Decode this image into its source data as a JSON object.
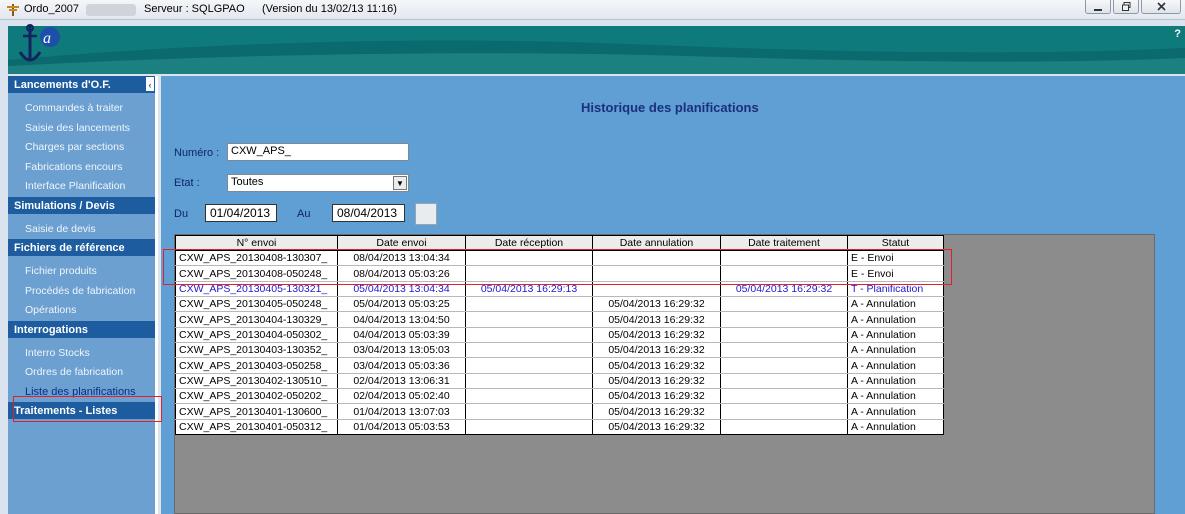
{
  "titlebar": {
    "app_name": "Ordo_2007",
    "server": "Serveur : SQLGPAO",
    "version": "(Version du 13/02/13 11:16)"
  },
  "banner": {
    "help": "?"
  },
  "sidebar": {
    "sections": [
      {
        "title": "Lancements d'O.F.",
        "items": [
          "Commandes à traiter",
          "Saisie des lancements",
          "Charges par sections",
          "Fabrications encours",
          "Interface Planification"
        ]
      },
      {
        "title": "Simulations / Devis",
        "items": [
          "Saisie de devis"
        ]
      },
      {
        "title": "Fichiers de référence",
        "items": [
          "Fichier produits",
          "Procédés de fabrication",
          "Opérations"
        ]
      },
      {
        "title": "Interrogations",
        "items": [
          "Interro Stocks",
          "Ordres de fabrication",
          "Liste des planifications"
        ]
      },
      {
        "title": "Traitements - Listes",
        "items": []
      }
    ],
    "collapse_glyph": "‹"
  },
  "form": {
    "title": "Historique des planifications",
    "numero_label": "Numéro :",
    "numero_value": "CXW_APS_",
    "etat_label": "Etat :",
    "etat_value": "Toutes",
    "du_label": "Du",
    "du_value": "01/04/2013",
    "au_label": "Au",
    "au_value": "08/04/2013"
  },
  "grid": {
    "columns": [
      "N° envoi",
      "Date envoi",
      "Date réception",
      "Date annulation",
      "Date traitement",
      "Statut"
    ],
    "rows": [
      [
        "CXW_APS_20130408-130307_",
        "08/04/2013 13:04:34",
        "",
        "",
        "",
        "E - Envoi"
      ],
      [
        "CXW_APS_20130408-050248_",
        "08/04/2013 05:03:26",
        "",
        "",
        "",
        "E - Envoi"
      ],
      [
        "CXW_APS_20130405-130321_",
        "05/04/2013 13:04:34",
        "05/04/2013 16:29:13",
        "",
        "05/04/2013 16:29:32",
        "T - Planification"
      ],
      [
        "CXW_APS_20130405-050248_",
        "05/04/2013 05:03:25",
        "",
        "05/04/2013 16:29:32",
        "",
        "A - Annulation"
      ],
      [
        "CXW_APS_20130404-130329_",
        "04/04/2013 13:04:50",
        "",
        "05/04/2013 16:29:32",
        "",
        "A - Annulation"
      ],
      [
        "CXW_APS_20130404-050302_",
        "04/04/2013 05:03:39",
        "",
        "05/04/2013 16:29:32",
        "",
        "A - Annulation"
      ],
      [
        "CXW_APS_20130403-130352_",
        "03/04/2013 13:05:03",
        "",
        "05/04/2013 16:29:32",
        "",
        "A - Annulation"
      ],
      [
        "CXW_APS_20130403-050258_",
        "03/04/2013 05:03:36",
        "",
        "05/04/2013 16:29:32",
        "",
        "A - Annulation"
      ],
      [
        "CXW_APS_20130402-130510_",
        "02/04/2013 13:06:31",
        "",
        "05/04/2013 16:29:32",
        "",
        "A - Annulation"
      ],
      [
        "CXW_APS_20130402-050202_",
        "02/04/2013 05:02:40",
        "",
        "05/04/2013 16:29:32",
        "",
        "A - Annulation"
      ],
      [
        "CXW_APS_20130401-130600_",
        "01/04/2013 13:07:03",
        "",
        "05/04/2013 16:29:32",
        "",
        "A - Annulation"
      ],
      [
        "CXW_APS_20130401-050312_",
        "01/04/2013 05:03:53",
        "",
        "05/04/2013 16:29:32",
        "",
        "A - Annulation"
      ]
    ],
    "highlighted_row_index": 2
  },
  "colors": {
    "banner": "#0e7a7c",
    "sidebar": "#6ba0d0",
    "sidebar_header": "#1d5d9f",
    "content": "#5f9fd4",
    "highlight_text": "#1a1ad0",
    "annotation_red": "#e0202a"
  }
}
